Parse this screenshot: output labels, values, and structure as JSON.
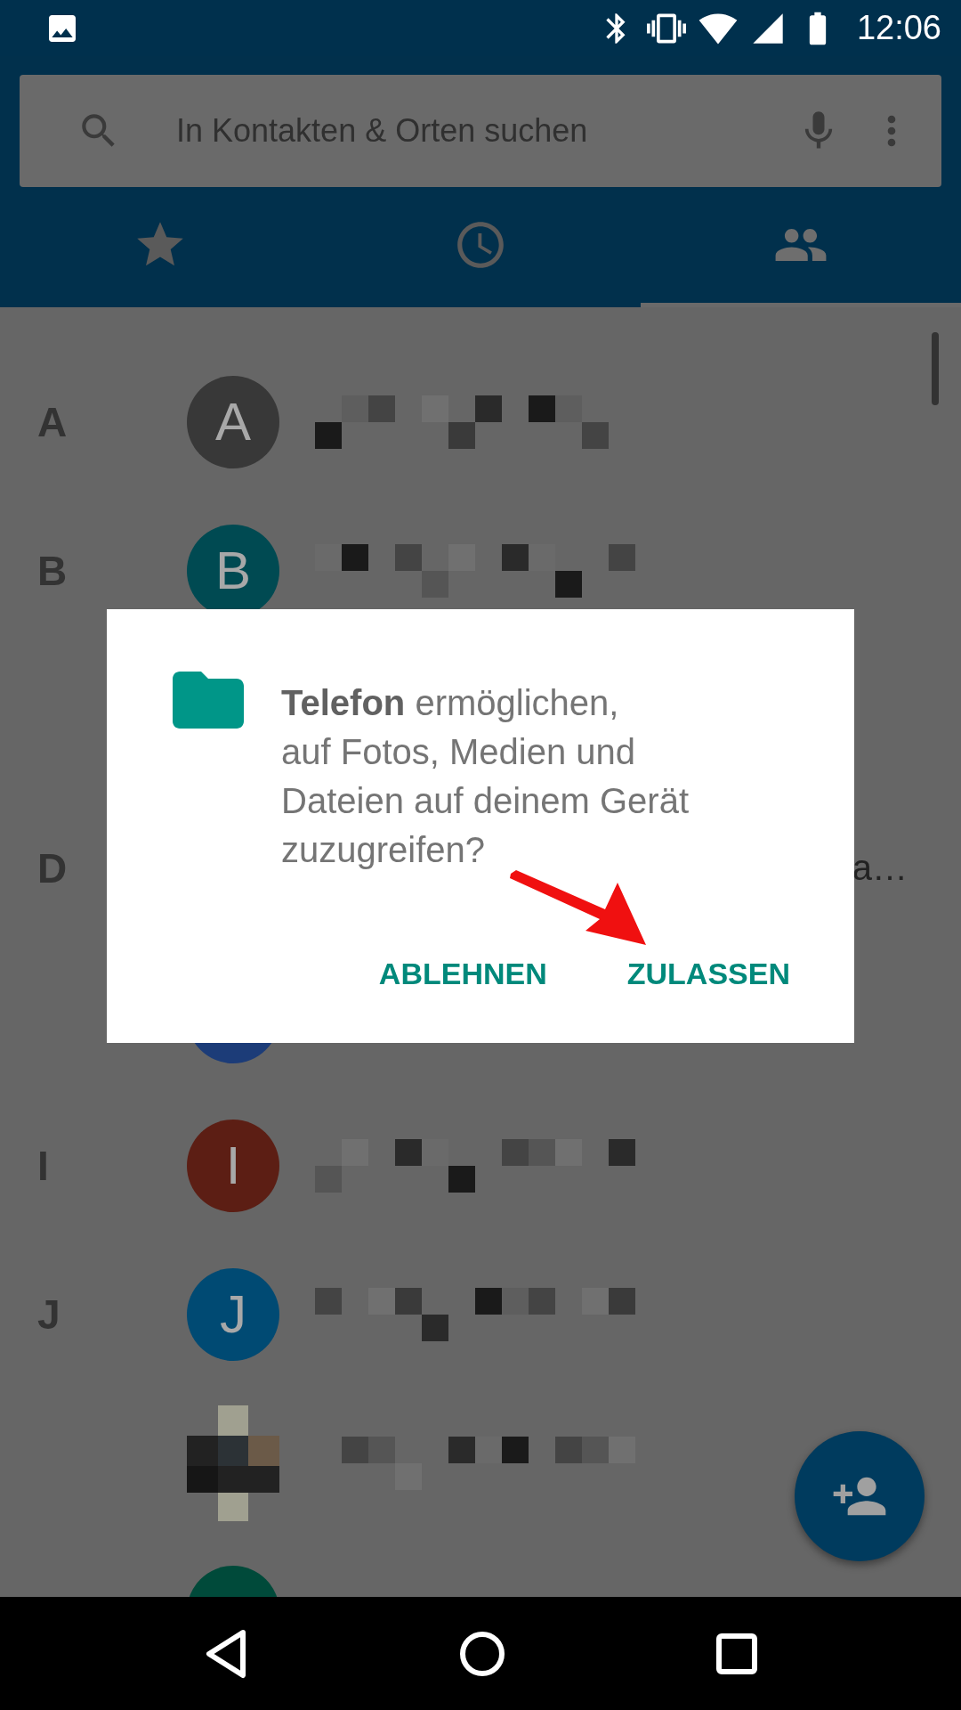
{
  "status_bar": {
    "time": "12:06"
  },
  "search": {
    "placeholder": "In Kontakten & Orten suchen"
  },
  "tabs": [
    {
      "kind": "star",
      "selected": false
    },
    {
      "kind": "clock",
      "selected": false
    },
    {
      "kind": "people",
      "selected": true
    }
  ],
  "contacts": [
    {
      "kind": "contact",
      "section": "A",
      "avatar": {
        "kind": "letter",
        "letter": "A",
        "color": "#383838"
      },
      "name_pixelated": true
    },
    {
      "kind": "contact",
      "section": "B",
      "avatar": {
        "kind": "letter",
        "letter": "B",
        "color": "#004a52"
      },
      "name_pixelated": true
    },
    {
      "kind": "covered"
    },
    {
      "kind": "contact",
      "section": "D",
      "trailing": "a…"
    },
    {
      "kind": "contact",
      "avatar": {
        "kind": "letter",
        "color": "#1c3c78"
      }
    },
    {
      "kind": "contact",
      "section": "I",
      "avatar": {
        "kind": "letter",
        "letter": "I",
        "color": "#5c1e14"
      },
      "name_pixelated": true
    },
    {
      "kind": "contact",
      "section": "J",
      "avatar": {
        "kind": "letter",
        "letter": "J",
        "color": "#004a73"
      },
      "name_pixelated": true
    },
    {
      "kind": "contact",
      "name_pixelated": true
    },
    {
      "kind": "contact",
      "avatar": {
        "kind": "letter",
        "color": "#004a3a"
      }
    }
  ],
  "dialog": {
    "message": "**Telefon** ermöglichen,\nauf Fotos, Medien und\nDateien auf deinem Gerät\nzuzugreifen?",
    "buttons": [
      "ABLEHNEN",
      "ZULASSEN"
    ]
  }
}
